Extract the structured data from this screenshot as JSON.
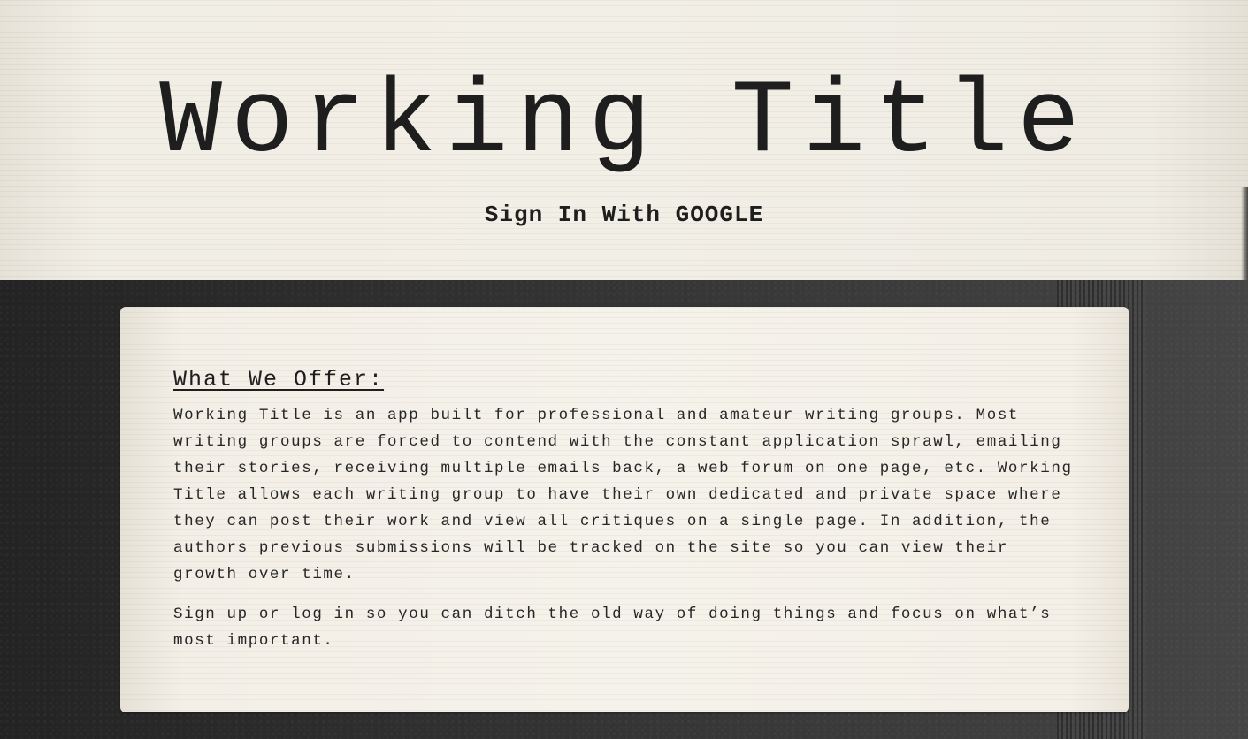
{
  "header": {
    "title": "Working Title",
    "signin_label": "Sign In With GOOGLE"
  },
  "offer": {
    "heading": "What We Offer:",
    "paragraphs": [
      "Working Title is an app built for professional and amateur writing groups. Most writing groups are forced to contend with the constant application sprawl, emailing their stories, receiving multiple emails back, a web forum on one page, etc. Working Title allows each writing group to have their own dedicated and private space where they can post their work and view all critiques on a single page. In addition, the authors previous submissions will be tracked on the site so you can view their growth over time.",
      "Sign up or log in so you can ditch the old way of doing things and focus on what’s most important."
    ]
  },
  "colors": {
    "paper": "#f2eee5",
    "ink": "#1e1e1e",
    "background_dark": "#2b2b2b"
  }
}
